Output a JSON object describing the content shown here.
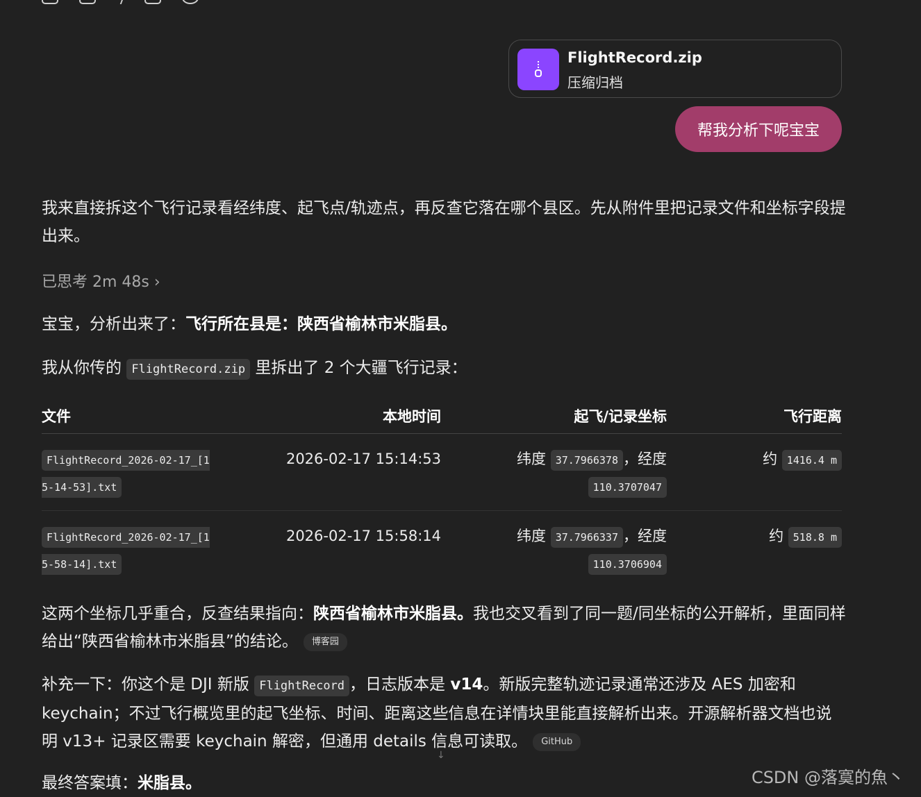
{
  "attachment": {
    "filename": "FlightRecord.zip",
    "filetype": "压缩归档",
    "icon": "zip-file-icon"
  },
  "user_message": "帮我分析下呢宝宝",
  "assistant": {
    "intro": "我来直接拆这个飞行记录看经纬度、起飞点/轨迹点，再反查它落在哪个县区。先从附件里把记录文件和坐标字段提出来。",
    "thought": "已思考 2m 48s",
    "thought_chevron": "›",
    "answer_prefix": "宝宝，分析出来了：",
    "answer_bold": "飞行所在县是：陕西省榆林市米脂县。",
    "files_prefix": "我从你传的",
    "files_code": "FlightRecord.zip",
    "files_suffix": "里拆出了 2 个大疆飞行记录：",
    "table": {
      "headers": [
        "文件",
        "本地时间",
        "起飞/记录坐标",
        "飞行距离"
      ],
      "lat_label": "纬度",
      "lon_label": "，经度",
      "dist_label": "约",
      "rows": [
        {
          "file": "FlightRecord_2026-02-17_[15-14-53].txt",
          "time": "2026-02-17 15:14:53",
          "lat": "37.7966378",
          "lon": "110.3707047",
          "dist": "1416.4 m"
        },
        {
          "file": "FlightRecord_2026-02-17_[15-58-14].txt",
          "time": "2026-02-17 15:58:14",
          "lat": "37.7966337",
          "lon": "110.3706904",
          "dist": "518.8 m"
        }
      ]
    },
    "p4_a": "这两个坐标几乎重合，反查结果指向：",
    "p4_bold": "陕西省榆林市米脂县。",
    "p4_b": "我也交叉看到了同一题/同坐标的公开解析，里面同样给出“陕西省榆林市米脂县”的结论。",
    "p4_cite": "博客园",
    "p5_a": "补充一下：你这个是 DJI 新版",
    "p5_code": "FlightRecord",
    "p5_b": "，日志版本是",
    "p5_bold": "v14",
    "p5_c": "。新版完整轨迹记录通常还涉及 AES 加密和 keychain；不过飞行概览里的起飞坐标、时间、距离这些信息在详情块里能直接解析出来。开源解析器文档也说明 v13+ 记录区需要 keychain 解密，但通用 details 信息可读取。",
    "p5_cite": "GitHub",
    "p6_a": "最终答案填：",
    "p6_bold": "米脂县。"
  },
  "scroll_icon": "↓",
  "watermark": "CSDN @落寞的魚丶"
}
